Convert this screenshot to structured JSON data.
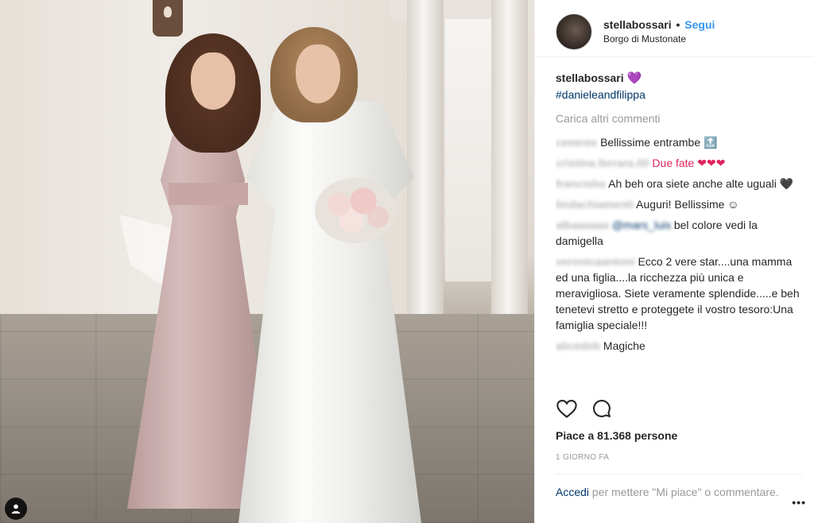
{
  "header": {
    "username": "stellabossari",
    "separator": "•",
    "follow_label": "Segui",
    "location": "Borgo di Mustonate"
  },
  "caption": {
    "username": "stellabossari",
    "emoji": "💜",
    "hashtag": "#danieleandfilippa"
  },
  "load_more_label": "Carica altri commenti",
  "comments": [
    {
      "user": "ceeeree",
      "text": "Bellissime entrambe 🔝"
    },
    {
      "user": "cristina.ferrara.00",
      "text": "Due fate ❤❤❤"
    },
    {
      "user": "francisbo",
      "text": "Ah beh ora siete anche alte uguali 🖤"
    },
    {
      "user": "lindachiamenti",
      "text": "Auguri! Bellissime ☺"
    },
    {
      "user": "albaaaaaa",
      "mention": "@mars_luis",
      "text": "bel colore vedi la damigella"
    },
    {
      "user": "veronicaantoni",
      "text": "Ecco 2 vere star....una mamma ed una figlia....la ricchezza più unica e meravigliosa. Siete veramente splendide.....e beh tenetevi stretto e proteggete il vostro tesoro:Una famiglia speciale!!!"
    },
    {
      "user": "alicedeb",
      "text": "Magiche"
    }
  ],
  "actions": {
    "like_icon": "heart-outline-icon",
    "comment_icon": "comment-bubble-icon"
  },
  "likes_text": "Piace a 81.368 persone",
  "timestamp": "1 GIORNO FA",
  "login": {
    "link_label": "Accedi",
    "rest": " per mettere \"Mi piace\" o commentare."
  },
  "more_label": "•••",
  "colors": {
    "accent_blue": "#3897f0",
    "link_navy": "#003569",
    "muted_gray": "#999999"
  }
}
